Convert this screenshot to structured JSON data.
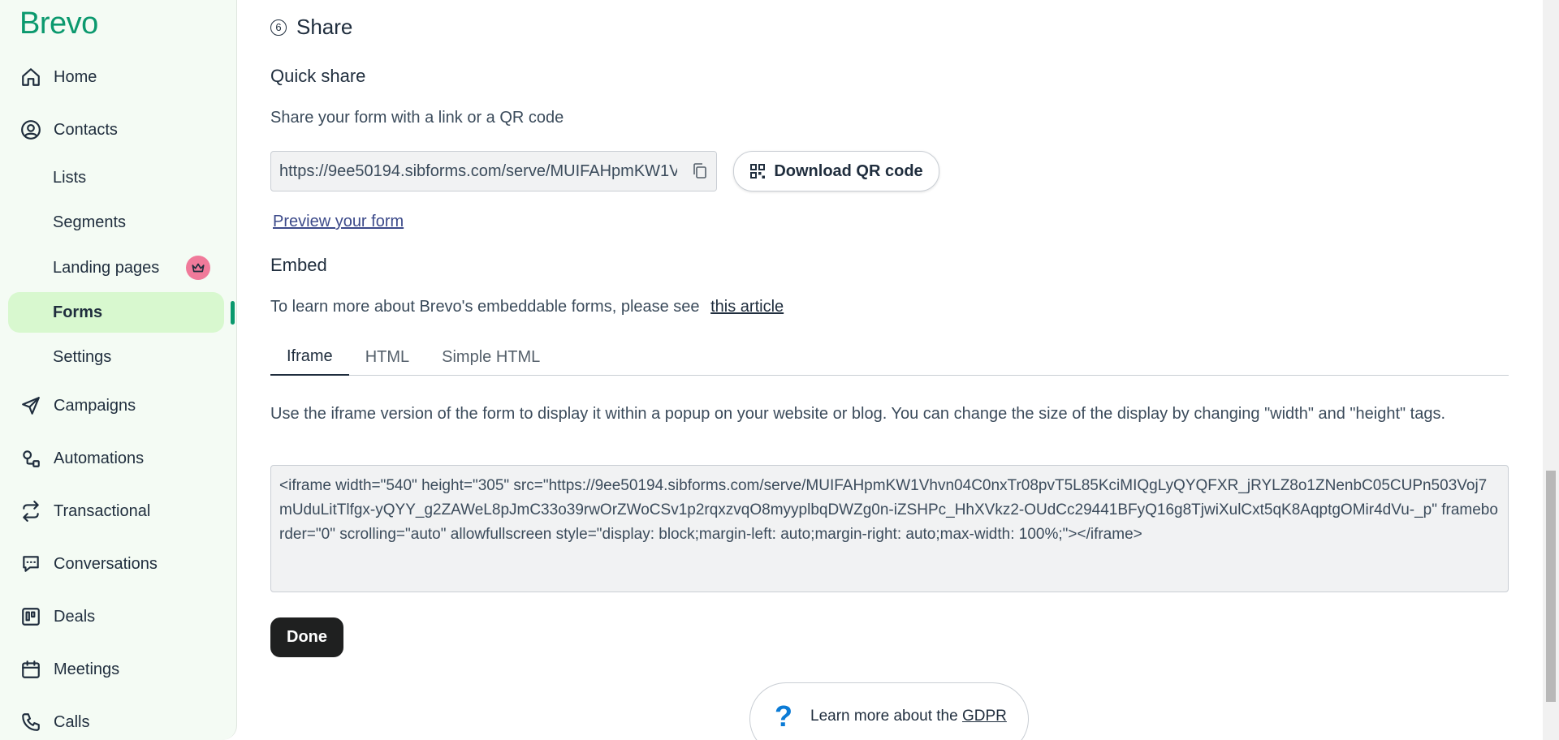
{
  "brand": {
    "logo": "Brevo",
    "color": "#0b996e"
  },
  "sidebar": {
    "items": [
      {
        "label": "Home",
        "icon": "home-icon"
      },
      {
        "label": "Contacts",
        "icon": "user-circle-icon"
      },
      {
        "label": "Lists",
        "sub": true
      },
      {
        "label": "Segments",
        "sub": true
      },
      {
        "label": "Landing pages",
        "sub": true,
        "badge": "crown-icon"
      },
      {
        "label": "Forms",
        "sub": true,
        "active": true
      },
      {
        "label": "Settings",
        "sub": true
      },
      {
        "label": "Campaigns",
        "icon": "send-icon"
      },
      {
        "label": "Automations",
        "icon": "automation-icon"
      },
      {
        "label": "Transactional",
        "icon": "arrows-swap-icon"
      },
      {
        "label": "Conversations",
        "icon": "chat-icon"
      },
      {
        "label": "Deals",
        "icon": "board-icon"
      },
      {
        "label": "Meetings",
        "icon": "calendar-icon"
      },
      {
        "label": "Calls",
        "icon": "phone-icon"
      }
    ]
  },
  "main": {
    "step_number": "6",
    "step_title": "Share",
    "quick_share": {
      "title": "Quick share",
      "description": "Share your form with a link or a QR code",
      "url": "https://9ee50194.sibforms.com/serve/MUIFAHpmKW1Vhvn04C0nxTr08pvT5L85KciMIQgLyQYQFXR_jRYLZ8o1ZNenbC05CUPn503Voj7mUduLitTlfgx-yQYY_g2ZAWeL8pJmC33o39rwOrZWoCSv1p2rqxzvqO8myyplbqDWZg0n-iZSHPc_HhXVkz2-OUdCc29441BFyQ16g8TjwiXulCxt5qK8AqptgOMir4dVu-_p",
      "qr_button": "Download QR code",
      "preview_link": "Preview your form"
    },
    "embed": {
      "title": "Embed",
      "description": "To learn more about Brevo's embeddable forms, please see",
      "article_link": "this article",
      "tabs": [
        "Iframe",
        "HTML",
        "Simple HTML"
      ],
      "active_tab": "Iframe",
      "iframe_description": "Use the iframe version of the form to display it within a popup on your website or blog. You can change the size of the display by changing \"width\" and \"height\" tags.",
      "code": "<iframe width=\"540\" height=\"305\" src=\"https://9ee50194.sibforms.com/serve/MUIFAHpmKW1Vhvn04C0nxTr08pvT5L85KciMIQgLyQYQFXR_jRYLZ8o1ZNenbC05CUPn503Voj7mUduLitTlfgx-yQYY_g2ZAWeL8pJmC33o39rwOrZWoCSv1p2rqxzvqO8myyplbqDWZg0n-iZSHPc_HhXVkz2-OUdCc29441BFyQ16g8TjwiXulCxt5qK8AqptgOMir4dVu-_p\" frameborder=\"0\" scrolling=\"auto\" allowfullscreen style=\"display: block;margin-left: auto;margin-right: auto;max-width: 100%;\"></iframe>"
    },
    "done_button": "Done",
    "gdpr": {
      "text": "Learn more about the",
      "link": "GDPR",
      "icon": "question-icon"
    }
  }
}
